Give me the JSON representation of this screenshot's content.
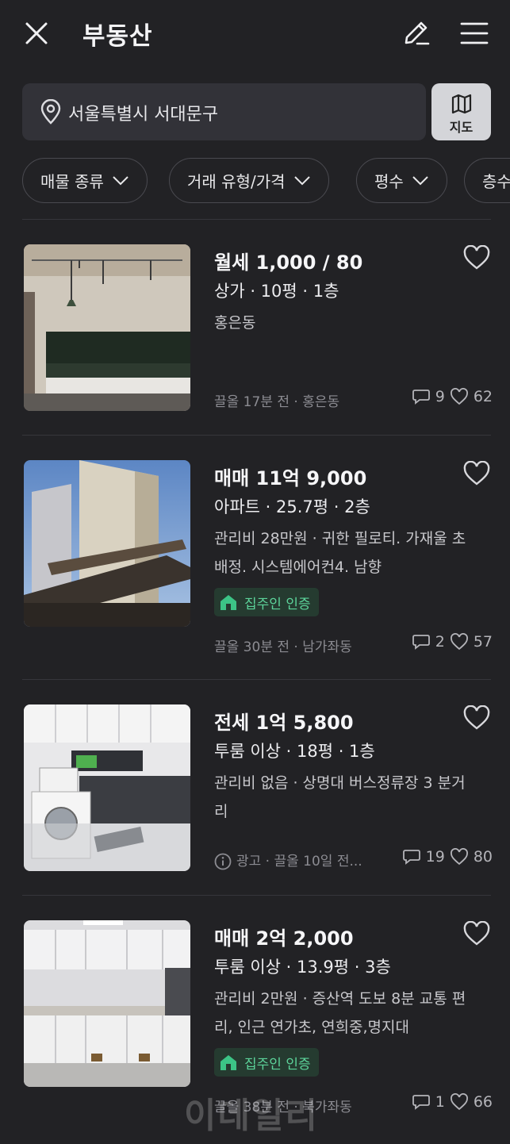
{
  "header": {
    "title": "부동산"
  },
  "search": {
    "location": "서울특별시 서대문구",
    "map_label": "지도"
  },
  "filters": [
    "매물 종류",
    "거래 유형/가격",
    "평수",
    "층수"
  ],
  "listings": [
    {
      "price": "월세 1,000 / 80",
      "meta": "상가 · 10평 · 1층",
      "desc": "홍은동",
      "badge": "",
      "footer": "끌올 17분 전 · 홍은동",
      "comments": "9",
      "likes": "62"
    },
    {
      "price": "매매 11억 9,000",
      "meta": "아파트 · 25.7평 · 2층",
      "desc": "관리비 28만원 · 귀한 필로티. 가재울 초 배정. 시스템에어컨4. 남향",
      "badge": "집주인 인증",
      "footer": "끌올 30분 전 · 남가좌동",
      "comments": "2",
      "likes": "57"
    },
    {
      "price": "전세 1억 5,800",
      "meta": "투룸 이상 · 18평 · 1층",
      "desc": "관리비 없음 · 상명대 버스정류장 3 분거리",
      "badge": "",
      "footer": "광고 · 끌올 10일 전...",
      "comments": "19",
      "likes": "80"
    },
    {
      "price": "매매 2억 2,000",
      "meta": "투룸 이상 · 13.9평 · 3층",
      "desc": "관리비 2만원 · 증산역 도보 8분 교통 편리, 인근 연가초, 연희중,명지대",
      "badge": "집주인 인증",
      "footer": "끌올 38분 전 · 북가좌동",
      "comments": "1",
      "likes": "66"
    }
  ],
  "watermark": "이데일리",
  "colors": {
    "background": "#222225",
    "badge_green": "#5cd39a",
    "map_button": "#d4d5d9"
  }
}
